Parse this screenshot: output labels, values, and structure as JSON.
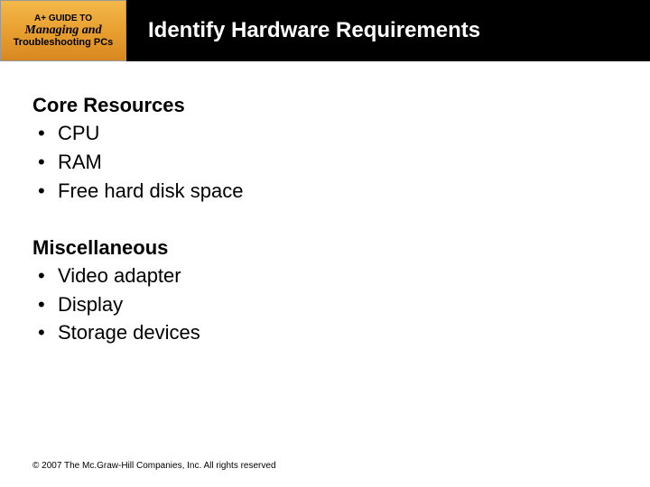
{
  "logo": {
    "line1": "A+ GUIDE TO",
    "line2": "Managing and",
    "line3": "Troubleshooting PCs"
  },
  "title": "Identify Hardware Requirements",
  "sections": [
    {
      "heading": "Core Resources",
      "items": [
        "CPU",
        "RAM",
        "Free hard disk space"
      ]
    },
    {
      "heading": "Miscellaneous",
      "items": [
        "Video adapter",
        "Display",
        "Storage devices"
      ]
    }
  ],
  "footer": "© 2007 The Mc.Graw-Hill Companies, Inc. All rights reserved"
}
